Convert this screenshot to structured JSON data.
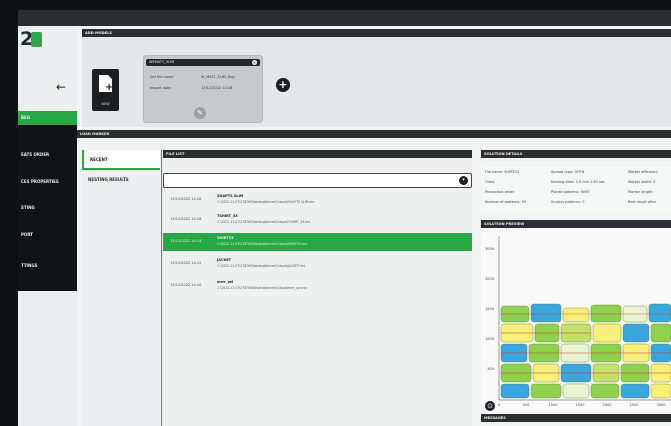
{
  "logo": {
    "text": "2"
  },
  "topbar": {},
  "sidebar": {
    "back_icon": "←",
    "items": [
      {
        "label": "BEG"
      },
      {
        "label": "EATS ORDER"
      },
      {
        "label": "CES PROPERTIES"
      },
      {
        "label": "STING"
      },
      {
        "label": "PORT"
      },
      {
        "label": "TTINGS"
      }
    ]
  },
  "add_models": {
    "section_title": "ADD MODELS",
    "new_label": "NEW",
    "card": {
      "title": "WEMAT1_5LIM",
      "close_icon": "✕",
      "rows": [
        {
          "label": "Dxf file name",
          "value": "W_MAT1_SLIM_Dxg"
        },
        {
          "label": "Import date",
          "value": "13/12/2022 14:18"
        }
      ],
      "edit_icon": "✎"
    },
    "add_icon": "+"
  },
  "load_marker": {
    "section_title": "LOAD MARKER"
  },
  "tabs": [
    {
      "label": "RECENT"
    },
    {
      "label": "NESTING RESULTS"
    }
  ],
  "file_list": {
    "section_title": "FILE LIST",
    "dropdown_icon": "▾",
    "rows": [
      {
        "date": "13/12/2022 14:18",
        "name": "SHAPTS SLIM",
        "path": "C:\\2022-11-07\\278765\\NestingServer\\Output\\SHAPTS SLIM.mrr"
      },
      {
        "date": "13/12/2022 14:16",
        "name": "TSHIRT_33",
        "path": "C:\\2022-11-07\\278765\\NestingServer\\Output\\TSHIRT_33.mrr"
      },
      {
        "date": "13/12/2022 14:14",
        "name": "SHIRT33",
        "path": "C:\\2022-11-07\\278765\\NestingServer\\Output\\SHIRT33.mrr"
      },
      {
        "date": "13/12/2022 14:12",
        "name": "JACKET",
        "path": "C:\\2022-11-07\\278765\\NestingServer\\Output\\JACKET.mrr"
      },
      {
        "date": "13/12/2022 14:10",
        "name": "mrrr_sel",
        "path": "C:\\2022-11-07\\278765\\NestingServer\\Output\\mrrr_sel.mrr"
      }
    ]
  },
  "solution_details": {
    "section_title": "SOLUTION DETAILS",
    "fields": [
      "File name: SHIRT33",
      "Spread type: OPEN",
      "Marker efficiency",
      "Order",
      "Nesting time: 1.5 min 2.63 sec",
      "Marker width: 9",
      "Production order",
      "Placed patterns: 9090",
      "Marker length:",
      "Number of patterns: 99",
      "Surplus patterns: 0",
      "Best result after"
    ]
  },
  "solution_preview": {
    "section_title": "SOLUTION PREVIEW",
    "y_ticks": [
      "3000",
      "2000",
      "1500",
      "1000",
      "500"
    ],
    "x_ticks": [
      "0",
      "500",
      "1000",
      "1500",
      "2000",
      "2500",
      "3000"
    ],
    "zoom_icon": "⊙",
    "colors": {
      "green": "#8fd14f",
      "yellow": "#f7ef7a",
      "blue": "#3aa6dd",
      "light": "#e8f4d0",
      "olive": "#c3e06a"
    }
  },
  "messages": {
    "section_title": "MESSAGES"
  }
}
